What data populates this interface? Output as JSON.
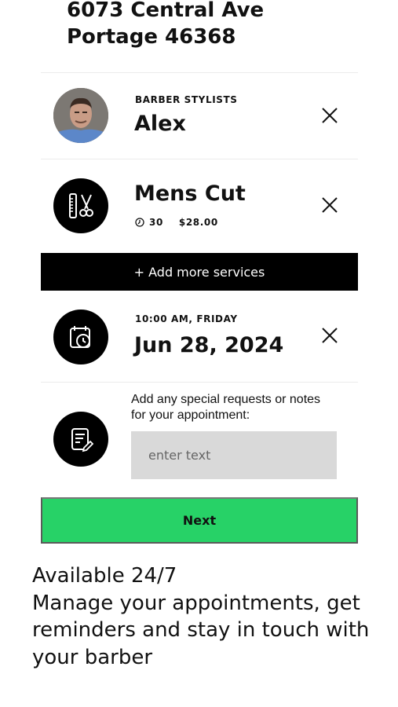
{
  "shop": {
    "address_line1": "6073 Central Ave",
    "address_line2": "Portage 46368"
  },
  "barber": {
    "category": "BARBER STYLISTS",
    "name": "Alex"
  },
  "service": {
    "name": "Mens Cut",
    "duration": "30",
    "price": "$28.00"
  },
  "add_services_label": "+ Add more services",
  "appointment": {
    "time_day": "10:00 AM,  FRIDAY",
    "date": "Jun 28, 2024"
  },
  "notes": {
    "label": "Add any special requests or notes for your appointment:",
    "placeholder": "enter text"
  },
  "next_label": "Next",
  "promo": {
    "line1": "Available 24/7",
    "line2": "Manage your appointments, get reminders and stay in touch with your barber"
  },
  "icons": {
    "barber": "barber-photo-avatar",
    "service": "comb-scissors-icon",
    "appointment": "calendar-clock-icon",
    "notes": "note-pencil-icon",
    "remove": "close-icon",
    "duration": "clock-icon"
  }
}
